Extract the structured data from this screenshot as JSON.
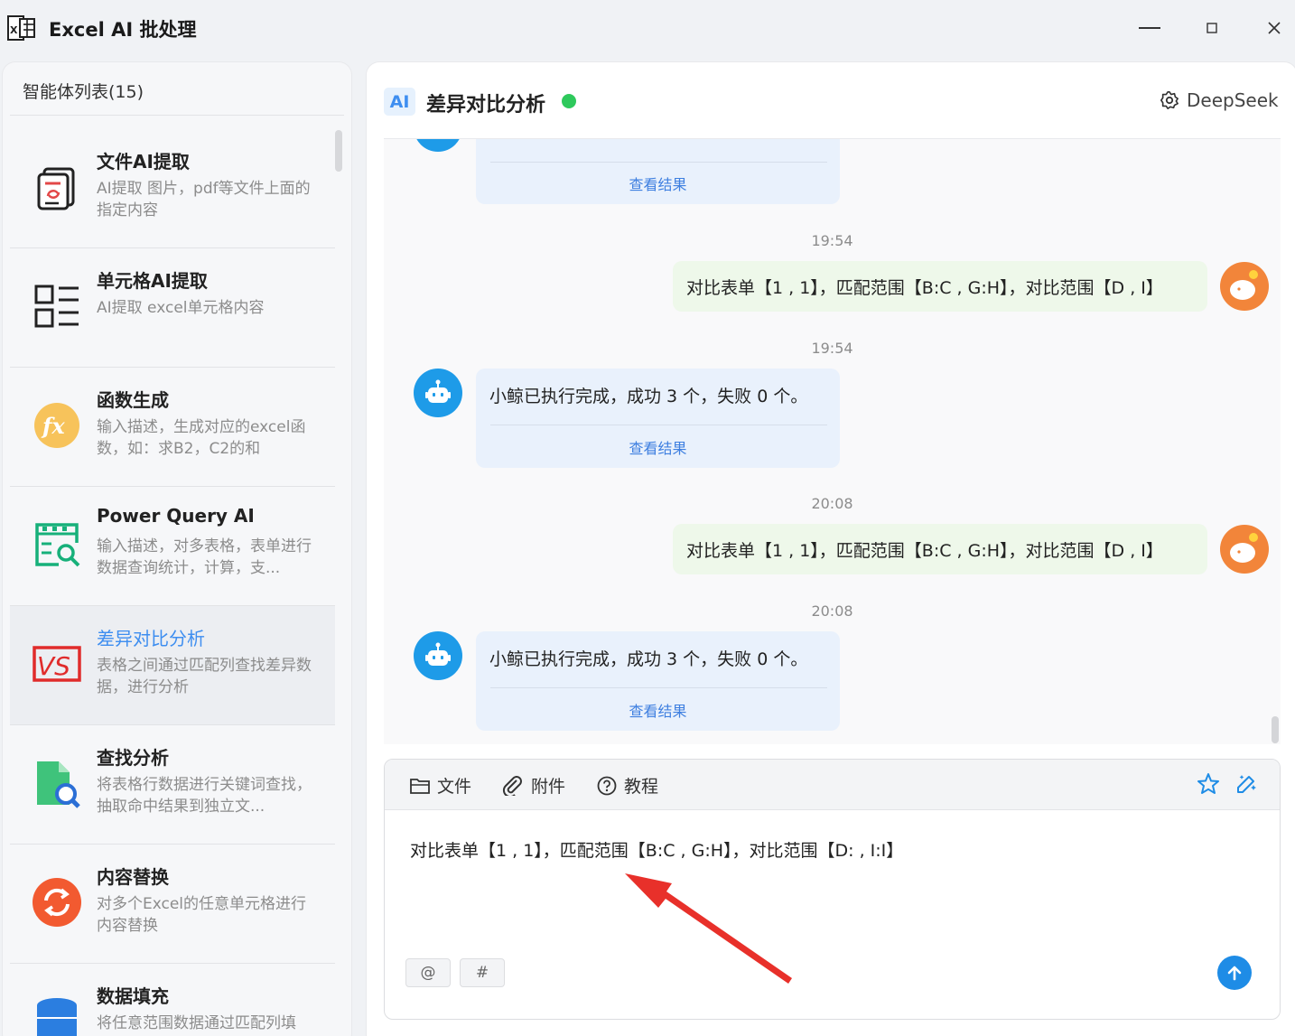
{
  "window": {
    "title": "Excel AI 批处理",
    "min_icon": "minimize-icon",
    "max_icon": "maximize-icon",
    "close_icon": "close-icon"
  },
  "sidebar": {
    "heading": "智能体列表(15)",
    "items": [
      {
        "title": "文件AI提取",
        "desc": "AI提取 图片，pdf等文件上面的指定内容",
        "icon": "document-extract-icon",
        "active": false
      },
      {
        "title": "单元格AI提取",
        "desc": "AI提取 excel单元格内容",
        "icon": "cell-list-icon",
        "active": false
      },
      {
        "title": "函数生成",
        "desc": "输入描述，生成对应的excel函数，如：求B2，C2的和",
        "icon": "fx-function-icon",
        "active": false
      },
      {
        "title": "Power Query AI",
        "desc": "输入描述，对多表格，表单进行数据查询统计，计算，支...",
        "icon": "query-table-icon",
        "active": false
      },
      {
        "title": "差异对比分析",
        "desc": "表格之间通过匹配列查找差异数据，进行分析",
        "icon": "vs-compare-icon",
        "active": true
      },
      {
        "title": "查找分析",
        "desc": "将表格行数据进行关键词查找，抽取命中结果到独立文...",
        "icon": "file-search-icon",
        "active": false
      },
      {
        "title": "内容替换",
        "desc": "对多个Excel的任意单元格进行内容替换",
        "icon": "replace-cycle-icon",
        "active": false
      },
      {
        "title": "数据填充",
        "desc": "将任意范围数据通过匹配列填",
        "icon": "database-icon",
        "active": false
      }
    ]
  },
  "chat": {
    "badge": "AI",
    "title": "差异对比分析",
    "status_color": "#2ec95c",
    "model_label": "DeepSeek",
    "model_icon": "gear-icon",
    "top_link": "查看结果",
    "messages": [
      {
        "time": "19:54",
        "user": "对比表单【1 , 1】，匹配范围【B:C , G:H】，对比范围【D , I】"
      },
      {
        "time": "19:54",
        "bot": "小鲸已执行完成，成功 3 个，失败 0 个。",
        "link": "查看结果"
      },
      {
        "time": "20:08",
        "user": "对比表单【1 , 1】，匹配范围【B:C , G:H】，对比范围【D , I】"
      },
      {
        "time": "20:08",
        "bot": "小鲸已执行完成，成功 3 个，失败 0 个。",
        "link": "查看结果"
      }
    ]
  },
  "composer": {
    "file_label": "文件",
    "attach_label": "附件",
    "tutorial_label": "教程",
    "input_value": "对比表单【1 , 1】，匹配范围【B:C , G:H】，对比范围【D: , I:I】",
    "tag_at": "@",
    "tag_hash": "#",
    "accent": "#1e8ce6"
  },
  "annotation": {
    "arrow_color": "#e8302a"
  }
}
